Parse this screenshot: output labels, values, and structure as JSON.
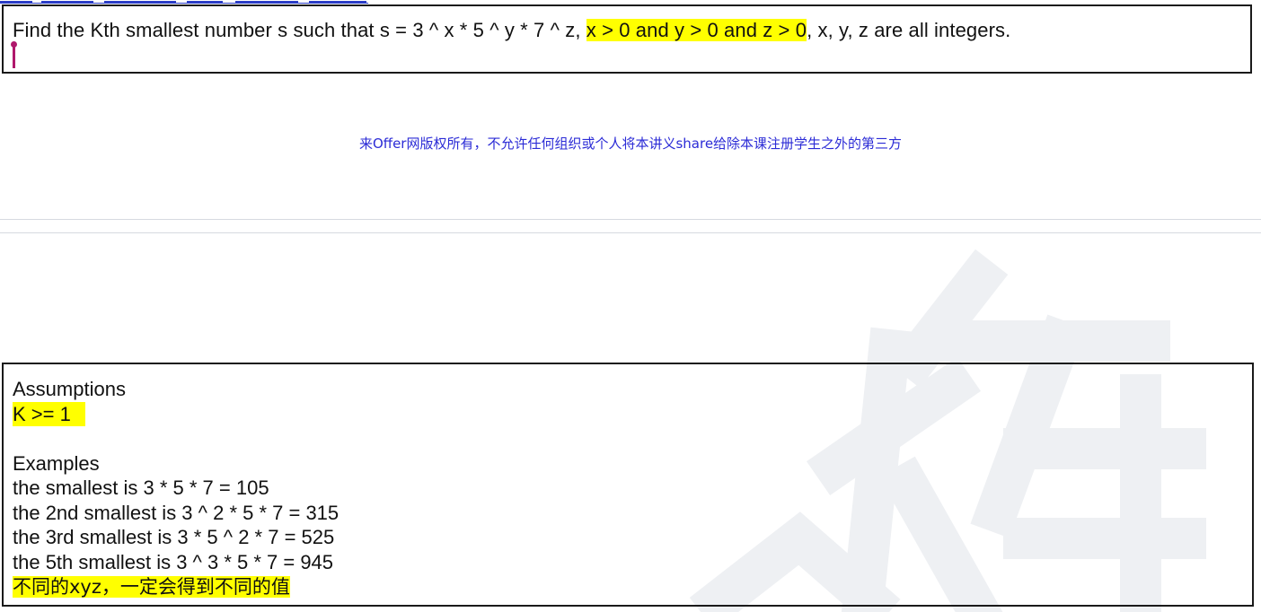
{
  "problem": {
    "text_before": "Find the Kth smallest number s such that s = 3 ^ x * 5 ^ y * 7 ^ z, ",
    "text_highlight": "x > 0 and y > 0 and z > 0",
    "text_after": ", x, y, z are all integers."
  },
  "copyright_notice": "来Offer网版权所有，不允许任何组织或个人将本讲义share给除本课注册学生之外的第三方",
  "details": {
    "assumptions_heading": "Assumptions",
    "assumption_k": "K >= 1",
    "examples_heading": "Examples",
    "examples": [
      "the smallest is 3 * 5 * 7 = 105",
      "the 2nd smallest is 3 ^ 2 * 5 * 7 = 315",
      "the 3rd smallest is 3 * 5 ^ 2 * 7 = 525",
      "the 5th smallest is 3 ^ 3 * 5 * 7 = 945"
    ],
    "note": "不同的xyz，一定会得到不同的值"
  },
  "colors": {
    "highlight": "#ffff00",
    "notice_text": "#2b2bd6",
    "cursor": "#b0186c",
    "box_border": "#1a1a1a",
    "watermark": "#eef0f3"
  }
}
